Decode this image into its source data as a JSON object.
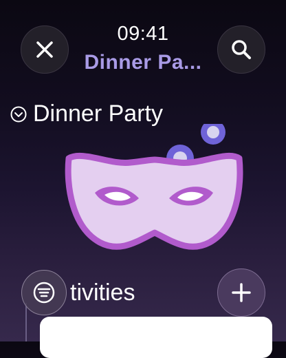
{
  "status_bar": {
    "time": "09:41"
  },
  "nav": {
    "title": "Dinner Pa..."
  },
  "section": {
    "title": "Dinner Party"
  },
  "activities": {
    "label": "tivities"
  },
  "icons": {
    "close": "close-icon",
    "search": "search-icon",
    "chevron": "chevron-down-circle-icon",
    "mask": "party-mask-icon",
    "filter": "filter-icon",
    "add": "plus-icon"
  },
  "colors": {
    "accent": "#a99be6",
    "mask_fill": "#e4cff0",
    "mask_stroke": "#b15bcc",
    "bubble": "#6f63d8"
  }
}
